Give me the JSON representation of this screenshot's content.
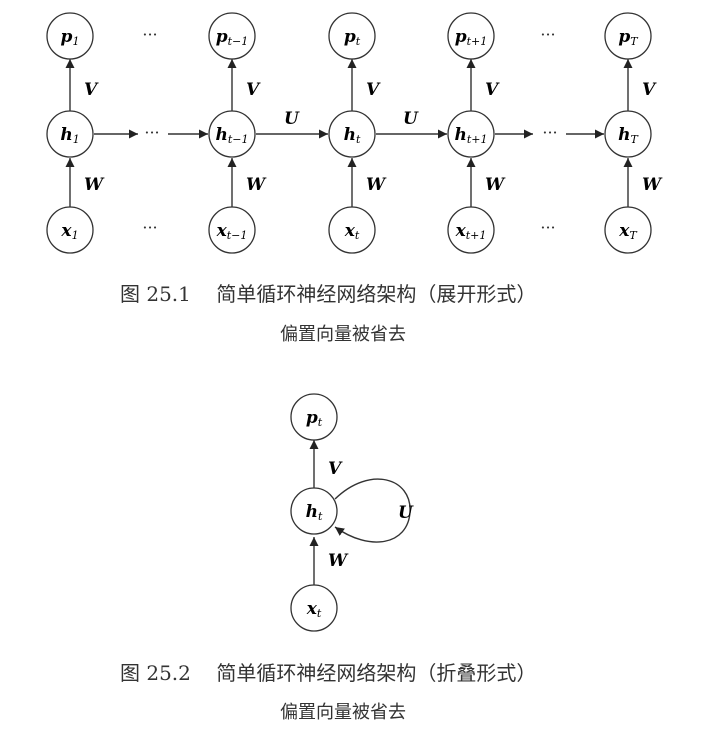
{
  "figure1": {
    "nodes": {
      "p1": {
        "base": "p",
        "sub": "1"
      },
      "pt_1": {
        "base": "p",
        "sub": "t−1"
      },
      "pt": {
        "base": "p",
        "sub": "t"
      },
      "pt1": {
        "base": "p",
        "sub": "t+1"
      },
      "pT": {
        "base": "p",
        "sub": "T"
      },
      "h1": {
        "base": "h",
        "sub": "1"
      },
      "ht_1": {
        "base": "h",
        "sub": "t−1"
      },
      "ht": {
        "base": "h",
        "sub": "t"
      },
      "ht1": {
        "base": "h",
        "sub": "t+1"
      },
      "hT": {
        "base": "h",
        "sub": "T"
      },
      "x1": {
        "base": "x",
        "sub": "1"
      },
      "xt_1": {
        "base": "x",
        "sub": "t−1"
      },
      "xt": {
        "base": "x",
        "sub": "t"
      },
      "xt1": {
        "base": "x",
        "sub": "t+1"
      },
      "xT": {
        "base": "x",
        "sub": "T"
      }
    },
    "edge_labels": {
      "V": "V",
      "W": "W",
      "U": "U"
    },
    "ellipsis": "···",
    "caption_number": "图 25.1",
    "caption_title": "简单循环神经网络架构（展开形式）",
    "caption_note": "偏置向量被省去"
  },
  "figure2": {
    "nodes": {
      "p": {
        "base": "p",
        "sub": "t"
      },
      "h": {
        "base": "h",
        "sub": "t"
      },
      "x": {
        "base": "x",
        "sub": "t"
      }
    },
    "edge_labels": {
      "V": "V",
      "W": "W",
      "U": "U"
    },
    "caption_number": "图 25.2",
    "caption_title": "简单循环神经网络架构（折叠形式）",
    "caption_note": "偏置向量被省去"
  }
}
